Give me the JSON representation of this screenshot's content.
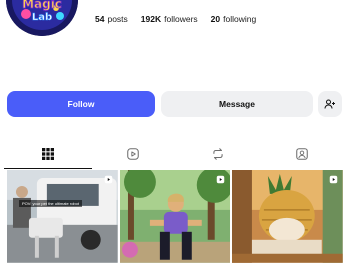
{
  "profile": {
    "avatar_logo_text": "Magic Lab",
    "stats": [
      {
        "value": "54",
        "label": "posts"
      },
      {
        "value": "192K",
        "label": "followers"
      },
      {
        "value": "20",
        "label": "following"
      }
    ]
  },
  "actions": {
    "follow_label": "Follow",
    "message_label": "Message",
    "add_user_icon": "person-add-icon"
  },
  "tabs": [
    {
      "name": "grid",
      "icon": "grid-icon",
      "active": true
    },
    {
      "name": "reels",
      "icon": "play-square-icon",
      "active": false
    },
    {
      "name": "reposts",
      "icon": "repost-icon",
      "active": false
    },
    {
      "name": "tagged",
      "icon": "tagged-person-icon",
      "active": false
    }
  ],
  "posts": [
    {
      "type": "reel",
      "caption": "POV: your pet the ultimate robot",
      "scene": "man with robot dog near SUV"
    },
    {
      "type": "reel",
      "caption": "",
      "scene": "woman stretching outdoors"
    },
    {
      "type": "reel",
      "caption": "",
      "scene": "pineapple-shaped bedroom"
    }
  ],
  "colors": {
    "accent": "#4a5df9",
    "secondary_button": "#eff0f2",
    "text": "#111111"
  }
}
